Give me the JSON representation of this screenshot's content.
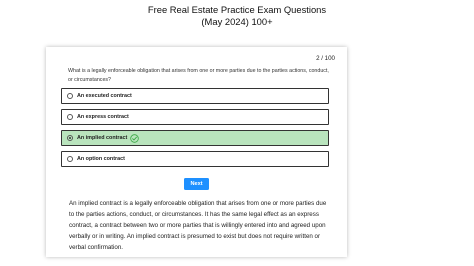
{
  "page": {
    "title_line1": "Free Real Estate Practice Exam Questions",
    "title_line2": "(May 2024) 100+"
  },
  "quiz": {
    "counter": "2 / 100",
    "question": "What is a legally enforceable obligation that arises from one or more parties due to the parties actions, conduct, or circumstances?",
    "options": [
      {
        "label": "An executed contract",
        "selected": false,
        "correct": false
      },
      {
        "label": "An express contract",
        "selected": false,
        "correct": false
      },
      {
        "label": "An implied contract",
        "selected": true,
        "correct": true
      },
      {
        "label": "An option contract",
        "selected": false,
        "correct": false
      }
    ],
    "next_label": "Next",
    "explanation": "An implied contract is a legally enforceable obligation that arises from one or more parties due to the parties actions, conduct, or circumstances. It has the same legal effect as an express contract, a contract between two or more parties that is willingly entered into and agreed upon verbally or in writing. An implied contract is presumed to exist but does not require written or verbal confirmation."
  },
  "colors": {
    "correct_bg": "#b9e4bd",
    "check_green": "#3aa845",
    "button_blue": "#1e90ff"
  },
  "icons": {
    "correct_marker": "check-circle-icon",
    "option_marker": "radio-icon"
  }
}
